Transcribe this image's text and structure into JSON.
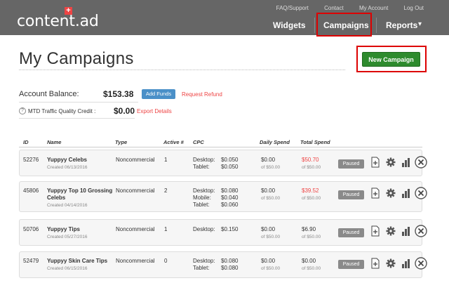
{
  "header": {
    "logo_text": "content.ad",
    "logo_mark": "+",
    "top_links": [
      "FAQ/Support",
      "Contact",
      "My Account",
      "Log Out"
    ],
    "nav": {
      "widgets": "Widgets",
      "campaigns": "Campaigns",
      "reports": "Reports",
      "reports_caret": "▾"
    }
  },
  "page": {
    "title": "My Campaigns",
    "new_campaign": "New Campaign"
  },
  "balance": {
    "label": "Account Balance:",
    "value": "$153.38",
    "add_funds": "Add Funds",
    "request_refund": "Request Refund",
    "mtd_icon": "?",
    "mtd_label": "MTD Traffic Quality Credit :",
    "mtd_value": "$0.00",
    "export": "Export Details"
  },
  "table": {
    "headers": {
      "id": "ID",
      "name": "Name",
      "type": "Type",
      "active": "Active #",
      "cpc": "CPC",
      "daily": "Daily Spend",
      "total": "Total Spend"
    },
    "rows": [
      {
        "id": "52276",
        "name": "Yuppyy Celebs",
        "created": "Created 06/13/2016",
        "type": "Noncommercial",
        "active": "1",
        "cpc_labels": [
          "Desktop:",
          "Tablet:"
        ],
        "cpc_values": [
          "$0.050",
          "$0.050"
        ],
        "daily": "$0.00",
        "daily_of": "of $50.00",
        "total": "$50.70",
        "total_of": "of $50.00",
        "status": "Paused"
      },
      {
        "id": "45806",
        "name": "Yuppyy Top 10 Grossing",
        "name2": "Celebs",
        "created": "Created 04/14/2016",
        "type": "Noncommercial",
        "active": "2",
        "cpc_labels": [
          "Desktop:",
          "Mobile:",
          "Tablet:"
        ],
        "cpc_values": [
          "$0.080",
          "$0.040",
          "$0.060"
        ],
        "daily": "$0.00",
        "daily_of": "of $50.00",
        "total": "$39.52",
        "total_of": "of $50.00",
        "status": "Paused"
      },
      {
        "id": "50706",
        "name": "Yuppyy Tips",
        "created": "Created 05/27/2016",
        "type": "Noncommercial",
        "active": "1",
        "cpc_labels": [
          "Desktop:"
        ],
        "cpc_values": [
          "$0.150"
        ],
        "daily": "$0.00",
        "daily_of": "of $50.00",
        "total": "$6.90",
        "total_of": "of $50.00",
        "status": "Paused"
      },
      {
        "id": "52479",
        "name": "Yuppyy Skin Care Tips",
        "created": "Created 06/15/2016",
        "type": "Noncommercial",
        "active": "0",
        "cpc_labels": [
          "Desktop:",
          "Tablet:"
        ],
        "cpc_values": [
          "$0.080",
          "$0.080"
        ],
        "daily": "$0.00",
        "daily_of": "of $50.00",
        "total": "$0.00",
        "total_of": "of $50.00",
        "status": "Paused"
      }
    ]
  },
  "colors": {
    "header_bg": "#666666",
    "accent_green": "#2e8b2e",
    "highlight_red": "#dd0000",
    "link_red": "#ee4444",
    "add_funds_blue": "#4a90c8"
  }
}
